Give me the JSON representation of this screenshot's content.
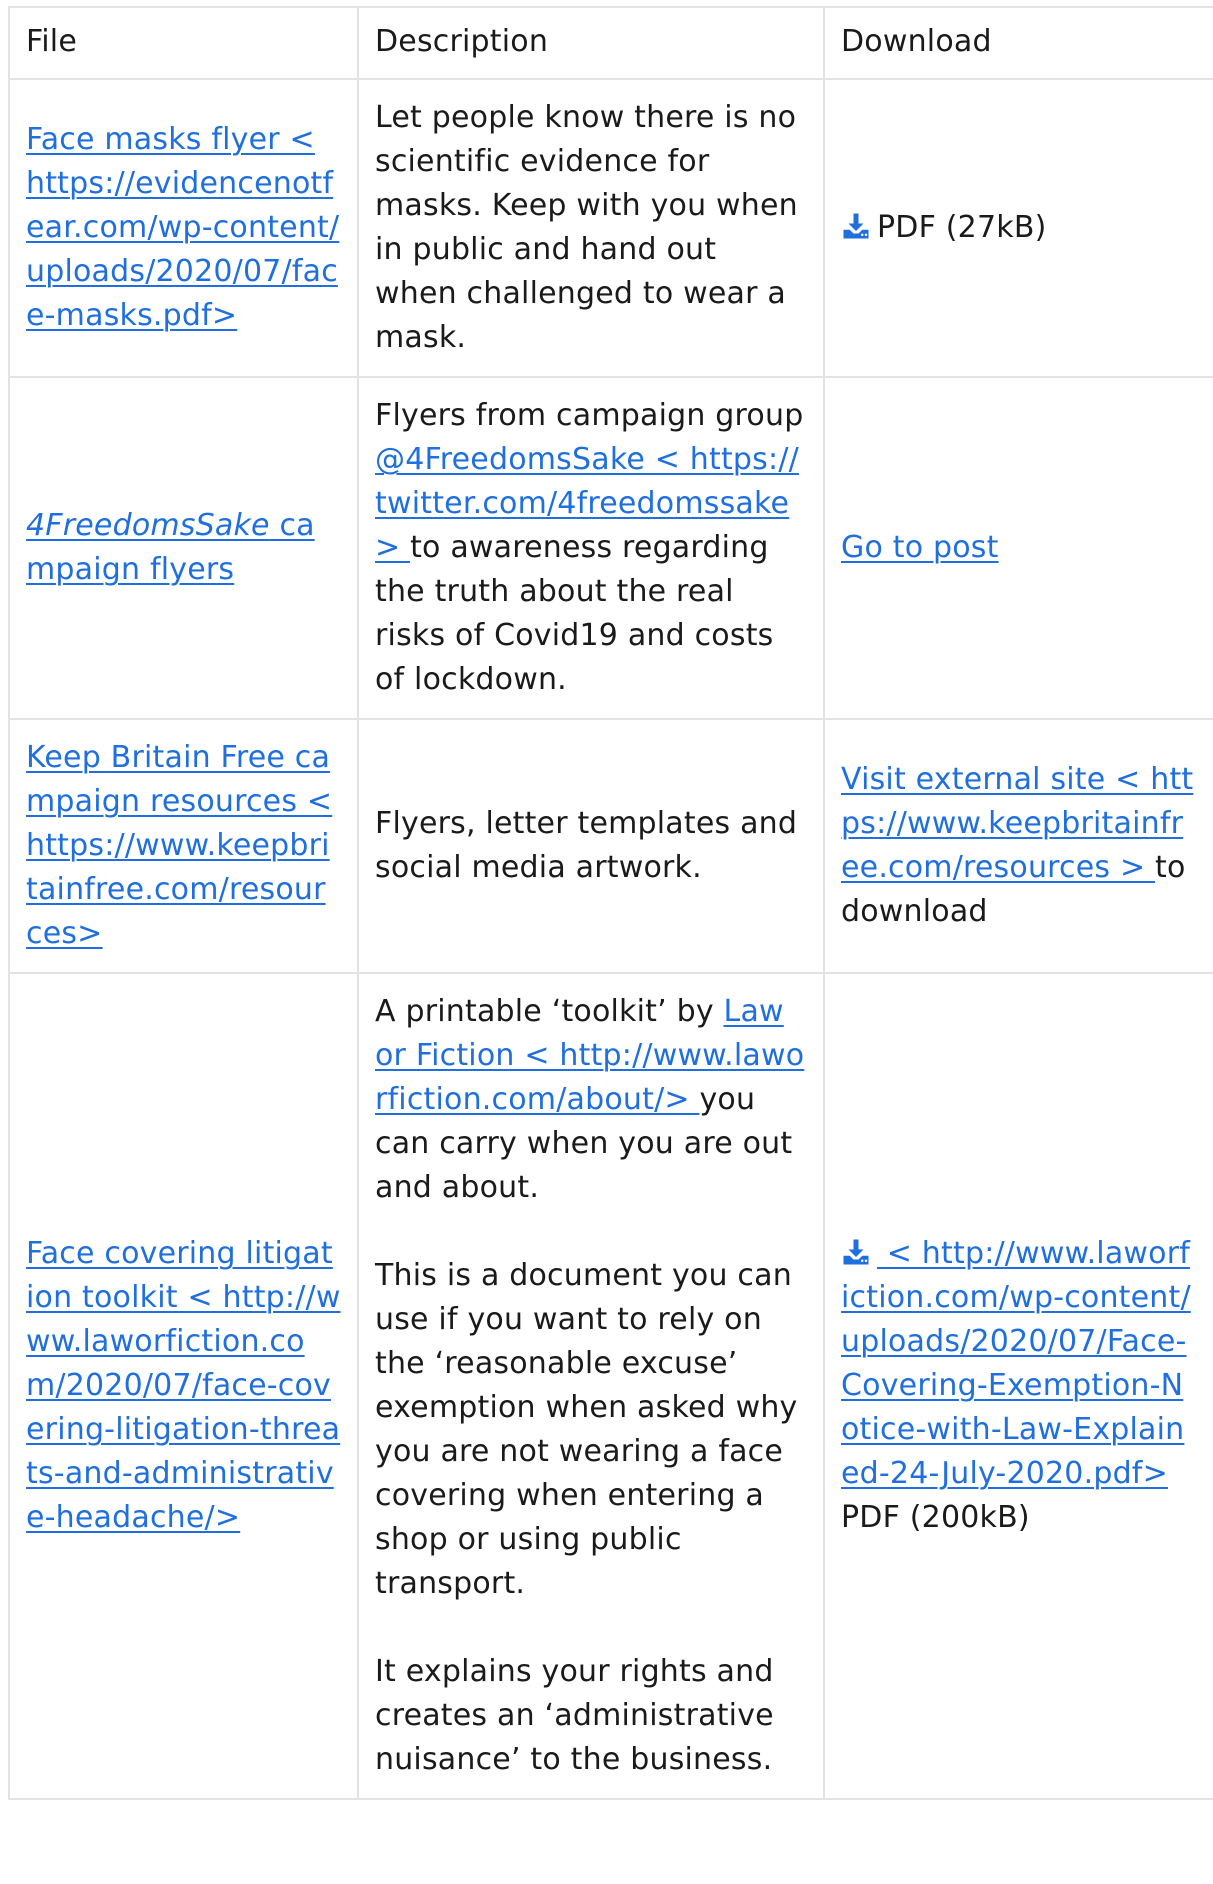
{
  "table": {
    "headers": {
      "file": "File",
      "description": "Description",
      "download": "Download"
    },
    "rows": [
      {
        "file_link": "Face masks flyer < https://evidencenotfear.com/wp-content/uploads/2020/07/face-masks.pdf>",
        "description": "Let people know there is no scientific evidence for masks. Keep with you when in public and hand out when challenged to wear a mask.",
        "download_icon": "download-icon",
        "download_text": "PDF (27kB)"
      },
      {
        "file_link_italic": "4FreedomsSake",
        "file_link_rest": " campaign flyers",
        "desc_before": "Flyers from campaign group ",
        "desc_link": "@4FreedomsSake < https://twitter.com/4freedomssake> ",
        "desc_after": "to awareness regarding the truth about the real risks of Covid19 and costs of lockdown.",
        "download_link": "Go to post"
      },
      {
        "file_link": "Keep Britain Free campaign resources < https://www.keepbritainfree.com/resources>",
        "description": "Flyers, letter templates and social media artwork.",
        "download_link": "Visit external site < https://www.keepbritainfree.com/resources > ",
        "download_after": "to download"
      },
      {
        "file_link": "Face covering litigation toolkit < http://www.laworfiction.com/2020/07/face-covering-litigation-threats-and-administrative-headache/>",
        "desc_p1_before": "A printable ‘toolkit’ by ",
        "desc_p1_link": "Law or Fiction < http://www.laworfiction.com/about/> ",
        "desc_p1_after": "you can carry when you are out and about.",
        "desc_p2": "This is a document you can use if you want to rely on the ‘reasonable excuse’ exemption when asked why you are not wearing a face covering when entering a shop or using public transport.",
        "desc_p3": "It explains your rights and creates an ‘administrative nuisance’ to the business.",
        "download_icon": "download-icon",
        "download_link": " < http://www.laworfiction.com/wp-content/uploads/2020/07/Face-Covering-Exemption-Notice-with-Law-Explained-24-July-2020.pdf>",
        "download_text": "PDF (200kB)"
      }
    ]
  },
  "colors": {
    "link": "#1f6fde",
    "text": "#1a1a1a",
    "border": "#e3e3e3"
  }
}
